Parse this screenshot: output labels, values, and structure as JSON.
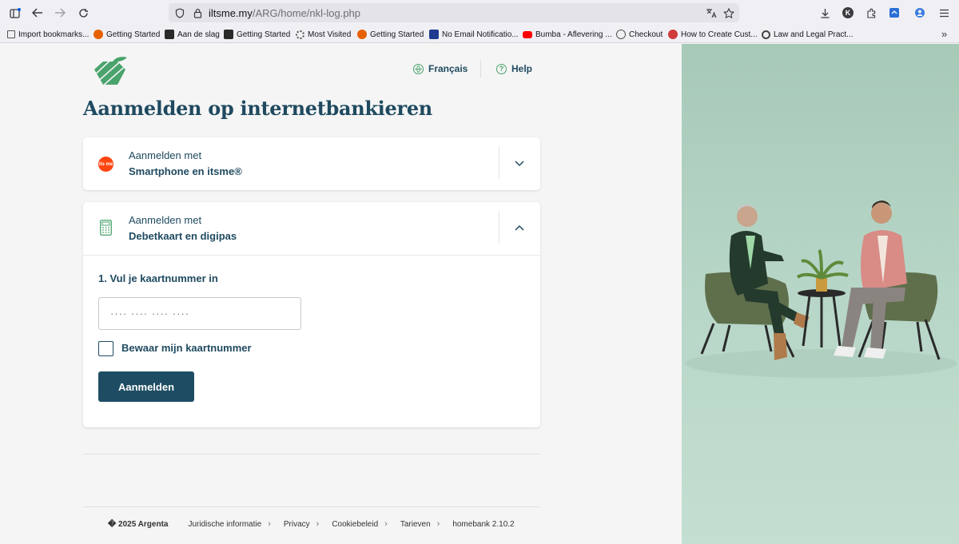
{
  "browser": {
    "url_host": "iltsme.my",
    "url_path": "/ARG/home/nkl-log.php",
    "bookmarks": [
      {
        "label": "Import bookmarks...",
        "color": "#555555"
      },
      {
        "label": "Getting Started",
        "color": "#e66000"
      },
      {
        "label": "Aan de slag",
        "color": "#2a2a2a"
      },
      {
        "label": "Getting Started",
        "color": "#2a2a2a"
      },
      {
        "label": "Most Visited",
        "color": "#555555"
      },
      {
        "label": "Getting Started",
        "color": "#e66000"
      },
      {
        "label": "No Email Notificatio...",
        "color": "#1d3c8f"
      },
      {
        "label": "Bumba - Aflevering ...",
        "color": "#ff0000"
      },
      {
        "label": "Checkout",
        "color": "#555555"
      },
      {
        "label": "How to Create Cust...",
        "color": "#d03a3a"
      },
      {
        "label": "Law and Legal Pract...",
        "color": "#444444"
      }
    ],
    "profile_initial": "K"
  },
  "header": {
    "language_label": "Français",
    "help_label": "Help"
  },
  "page": {
    "title": "Aanmelden op internetbankieren"
  },
  "login_options": [
    {
      "prefix": "Aanmelden met",
      "method": "Smartphone en itsme®",
      "icon_text": "its me",
      "expanded": false
    },
    {
      "prefix": "Aanmelden met",
      "method": "Debetkaart en digipas",
      "expanded": true
    }
  ],
  "card_form": {
    "step_label": "1. Vul je kaartnummer in",
    "card_number_placeholder": "···· ···· ···· ····",
    "remember_label": "Bewaar mijn kaartnummer",
    "remember_checked": false,
    "submit_label": "Aanmelden"
  },
  "footer": {
    "copyright": "� 2025 Argenta",
    "links": [
      "Juridische informatie",
      "Privacy",
      "Cookiebeleid",
      "Tarieven"
    ],
    "version": "homebank 2.10.2"
  },
  "colors": {
    "brand_dark": "#1f4a60",
    "brand_green": "#4aa36c",
    "itsme_orange": "#ff4612",
    "hero_bg": "#b7d6c7"
  }
}
